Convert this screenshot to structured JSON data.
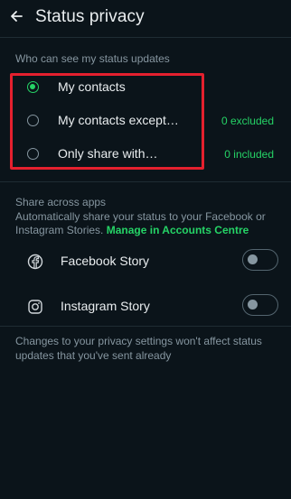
{
  "header": {
    "title": "Status privacy",
    "back_icon": "arrow-left-icon"
  },
  "audience": {
    "section_title": "Who can see my status updates",
    "selected": "My contacts",
    "options": [
      {
        "label": "My contacts",
        "count": "",
        "checked": true
      },
      {
        "label": "My contacts except…",
        "count": "0 excluded",
        "checked": false
      },
      {
        "label": "Only share with…",
        "count": "0 included",
        "checked": false
      }
    ]
  },
  "share": {
    "title": "Share across apps",
    "description": "Automatically share your status to your Facebook or Instagram Stories.",
    "link": "Manage in Accounts Centre",
    "apps": [
      {
        "label": "Facebook Story",
        "icon": "facebook-icon",
        "enabled": false
      },
      {
        "label": "Instagram Story",
        "icon": "instagram-icon",
        "enabled": false
      }
    ]
  },
  "footer": {
    "note": "Changes to your privacy settings won't affect status updates that you've sent already"
  },
  "colors": {
    "background": "#0b141a",
    "accent": "#25d366",
    "highlight": "#e5202e",
    "muted": "#8696a0"
  }
}
